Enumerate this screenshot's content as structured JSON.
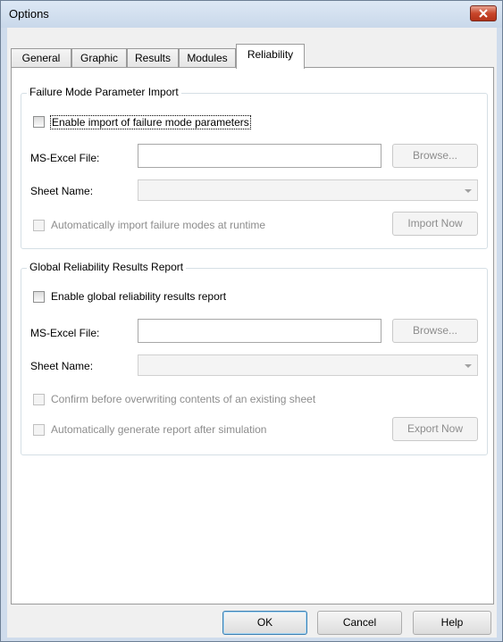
{
  "window": {
    "title": "Options"
  },
  "tabs": [
    {
      "label": "General"
    },
    {
      "label": "Graphic"
    },
    {
      "label": "Results"
    },
    {
      "label": "Modules"
    },
    {
      "label": "Reliability"
    }
  ],
  "failure_group": {
    "title": "Failure Mode Parameter Import",
    "enable_label": "Enable import of failure mode parameters",
    "file_label": "MS-Excel File:",
    "file_value": "",
    "browse_label": "Browse...",
    "sheet_label": "Sheet Name:",
    "sheet_value": "",
    "auto_label": "Automatically import failure modes at runtime",
    "import_label": "Import Now"
  },
  "report_group": {
    "title": "Global Reliability Results Report",
    "enable_label": "Enable global reliability results report",
    "file_label": "MS-Excel File:",
    "file_value": "",
    "browse_label": "Browse...",
    "sheet_label": "Sheet Name:",
    "sheet_value": "",
    "confirm_label": "Confirm before overwriting contents of an existing sheet",
    "auto_label": "Automatically generate report after simulation",
    "export_label": "Export Now"
  },
  "footer": {
    "ok_label": "OK",
    "cancel_label": "Cancel",
    "help_label": "Help"
  },
  "colors": {
    "frame": "#cfdcec",
    "close": "#c8462b",
    "group_border": "#d5dfe5"
  }
}
